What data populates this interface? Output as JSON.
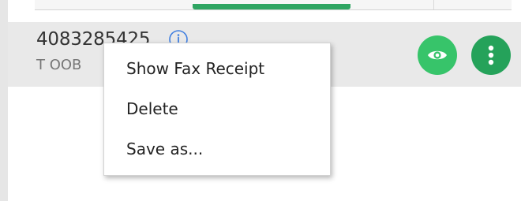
{
  "colors": {
    "accent_green": "#2fa562",
    "eye_button_bg": "#37c46a",
    "more_button_bg": "#25a25a",
    "info_icon": "#3f7ee0",
    "row_bg": "#e9e9e9"
  },
  "row": {
    "number": "4083285425",
    "subtitle": "T OOB",
    "info_icon": "info-circle-icon",
    "view_icon": "eye-icon",
    "more_icon": "vertical-ellipsis-icon"
  },
  "context_menu": {
    "items": [
      {
        "label": "Show Fax Receipt"
      },
      {
        "label": "Delete"
      },
      {
        "label": "Save as..."
      }
    ]
  }
}
